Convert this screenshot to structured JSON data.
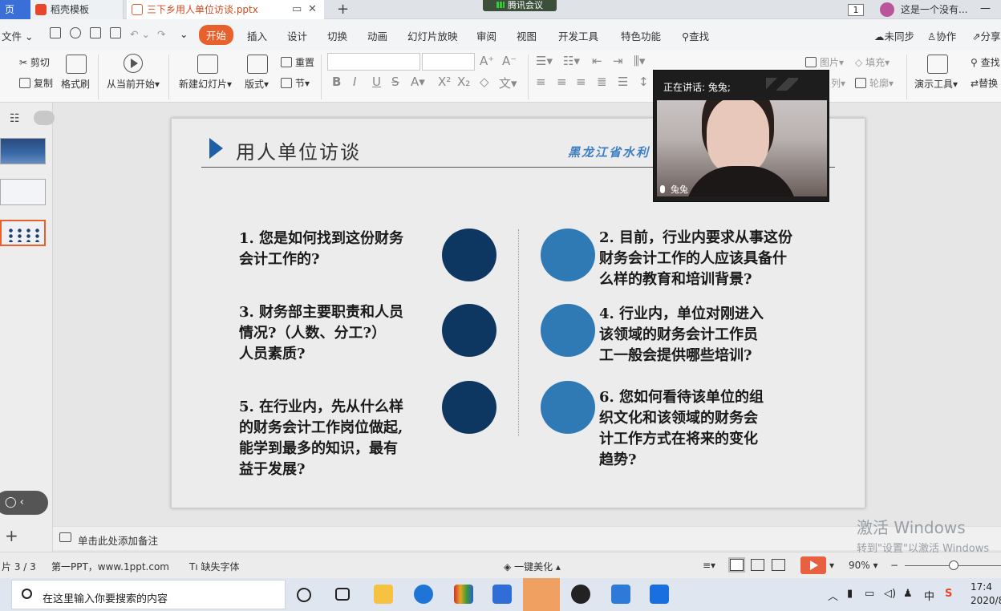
{
  "tabs": [
    {
      "label": "页"
    },
    {
      "label": "稻壳模板"
    },
    {
      "label": "三下乡用人单位访谈.pptx"
    }
  ],
  "meeting": {
    "label": "腾讯会议"
  },
  "page_badge": "1",
  "user": {
    "name": "这是一个没有..."
  },
  "menu": {
    "file": "文件",
    "items": [
      "开始",
      "插入",
      "设计",
      "切换",
      "动画",
      "幻灯片放映",
      "审阅",
      "视图",
      "开发工具",
      "特色功能"
    ],
    "find": "查找",
    "sync": "未同步",
    "collab": "协作",
    "share": "分享"
  },
  "ribbon": {
    "cut": "剪切",
    "copy": "复制",
    "format_painter": "格式刷",
    "from_start": "从当前开始",
    "new_slide": "新建幻灯片",
    "layout": "版式",
    "reset": "重置",
    "section": "节",
    "picture": "图片",
    "fill": "填充",
    "arrange": "列",
    "outline": "轮廓",
    "present_tools": "演示工具",
    "find": "查找",
    "replace": "替换"
  },
  "video": {
    "speaking": "正在讲话: 兔兔;",
    "participant": "兔兔"
  },
  "slide": {
    "title": "用人单位访谈",
    "org": "黑龙江省水利",
    "questions": [
      "1. 您是如何找到这份财务\n会计工作的?",
      "2. 目前，行业内要求从事这份\n财务会计工作的人应该具备什\n么样的教育和培训背景?",
      "3. 财务部主要职责和人员\n情况?（人数、分工?）\n人员素质?",
      "4. 行业内，单位对刚进入\n该领域的财务会计工作员\n工一般会提供哪些培训?",
      "5. 在行业内，先从什么样\n的财务会计工作岗位做起,\n能学到最多的知识，最有\n益于发展?",
      "6. 您如何看待该单位的组\n织文化和该领域的财务会\n计工作方式在将来的变化\n趋势?"
    ]
  },
  "notes_placeholder": "单击此处添加备注",
  "status": {
    "slide_counter": "片 3 / 3",
    "theme": "第一PPT，www.1ppt.com",
    "missing_font": "缺失字体",
    "beautify": "一键美化",
    "zoom": "90%"
  },
  "watermark": {
    "line1": "激活 Windows",
    "line2": "转到\"设置\"以激活 Windows"
  },
  "taskbar": {
    "search_placeholder": "在这里输入你要搜索的内容",
    "ime": "中",
    "time": "17:4",
    "date": "2020/8"
  },
  "colors": {
    "accent": "#e8602c",
    "dark_circle": "#0d3660",
    "light_circle": "#2f79b5",
    "title_triangle": "#1f5fa6"
  }
}
